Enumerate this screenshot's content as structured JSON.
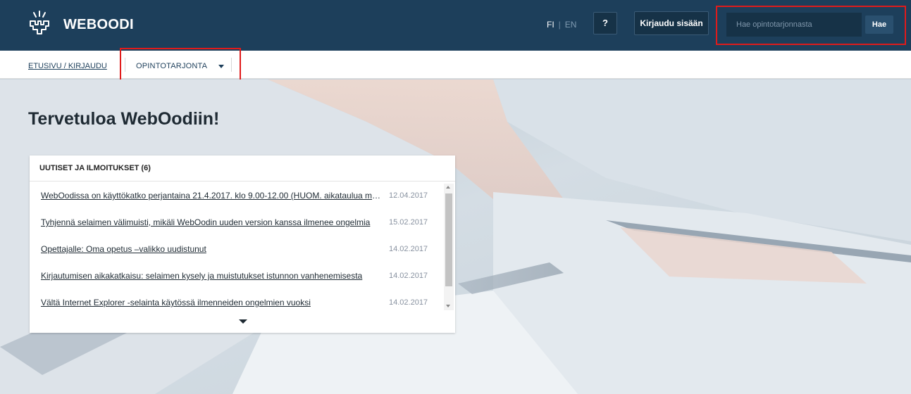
{
  "header": {
    "brand": "WEBOODI",
    "lang_fi": "FI",
    "lang_sep": "|",
    "lang_en": "EN",
    "help_label": "?",
    "login_label": "Kirjaudu sisään",
    "search_placeholder": "Hae opintotarjonnasta",
    "search_button": "Hae"
  },
  "nav": {
    "breadcrumb": "ETUSIVU / KIRJAUDU",
    "menu_label": "OPINTOTARJONTA"
  },
  "main": {
    "title": "Tervetuloa WebOodiin!"
  },
  "news": {
    "heading": "UUTISET JA ILMOITUKSET (6)",
    "items": [
      {
        "title": "WebOodissa on käyttökatko perjantaina 21.4.2017. klo 9.00-12.00 (HUOM. aikataulua muutettu)",
        "date": "12.04.2017"
      },
      {
        "title": "Tyhjennä selaimen välimuisti, mikäli WebOodin uuden version kanssa ilmenee ongelmia",
        "date": "15.02.2017"
      },
      {
        "title": "Opettajalle: Oma opetus –valikko uudistunut",
        "date": "14.02.2017"
      },
      {
        "title": "Kirjautumisen aikakatkaisu: selaimen kysely ja muistutukset istunnon vanhenemisesta",
        "date": "14.02.2017"
      },
      {
        "title": "Vältä Internet Explorer -selainta käytössä ilmenneiden ongelmien vuoksi",
        "date": "14.02.2017"
      }
    ]
  },
  "colors": {
    "header_bg": "#1d3f5b",
    "highlight": "#e01b1b"
  }
}
